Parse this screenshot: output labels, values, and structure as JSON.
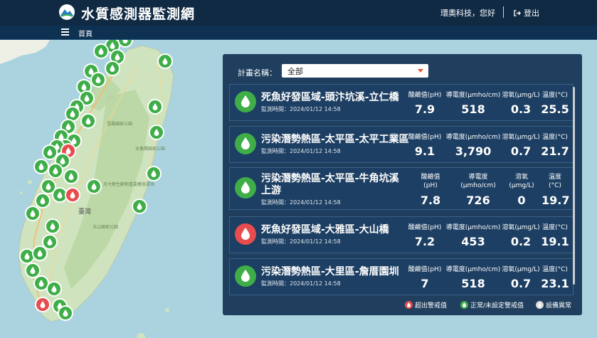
{
  "header": {
    "app_title": "水質感測器監測網",
    "greeting": "環奧科技，您好",
    "logout_label": "登出"
  },
  "nav": {
    "home_label": "首頁"
  },
  "colors": {
    "alert": "#e84c4f",
    "normal": "#3fae49",
    "abnormal": "#d9d9d9",
    "panel": "#163454"
  },
  "map": {
    "labels": [
      "臺灣",
      "玉山國家公園",
      "太魯閣國家公園",
      "雪霸國家公園",
      "月大野生動物重要棲息環境"
    ]
  },
  "filter": {
    "label": "計畫名稱：",
    "selected": "全部"
  },
  "stations": [
    {
      "name": "死魚好發區域-頭汴坑溪-立仁橋",
      "time": "監測時間：2024/01/12 14:58",
      "status": "normal",
      "labels": {
        "ph": "酸鹼值(pH)",
        "ec": "導電度(μmho/cm)",
        "do": "溶氧(μmg/L)",
        "temp": "溫度(°C)"
      },
      "values": {
        "ph": "7.9",
        "ec": "518",
        "do": "0.3",
        "temp": "25.5"
      }
    },
    {
      "name": "污染潛勢熱區-太平區-太平工業區",
      "time": "監測時間：2024/01/12 14:58",
      "status": "normal",
      "labels": {
        "ph": "酸鹼值(pH)",
        "ec": "導電度(μmho/cm)",
        "do": "溶氧(μmg/L)",
        "temp": "溫度(°C)"
      },
      "values": {
        "ph": "9.1",
        "ec": "3,790",
        "do": "0.7",
        "temp": "21.7"
      }
    },
    {
      "name": "污染潛勢熱區-太平區-牛角坑溪上游",
      "time": "監測時間：2024/01/12 14:58",
      "status": "normal",
      "labels": {
        "ph_a": "酸鹼值",
        "ph_b": "(pH)",
        "ec_a": "導電度",
        "ec_b": "(μmho/cm)",
        "do_a": "溶氧",
        "do_b": "(μmg/L)",
        "temp_a": "溫度",
        "temp_b": "(°C)"
      },
      "values": {
        "ph": "7.8",
        "ec": "726",
        "do": "0",
        "temp": "19.7"
      }
    },
    {
      "name": "死魚好發區域-大雅區-大山橋",
      "time": "監測時間：2024/01/12 14:58",
      "status": "alert",
      "labels": {
        "ph": "酸鹼值(pH)",
        "ec": "導電度(μmho/cm)",
        "do": "溶氧(μmg/L)",
        "temp": "溫度(°C)"
      },
      "values": {
        "ph": "7.2",
        "ec": "453",
        "do": "0.2",
        "temp": "19.1"
      }
    },
    {
      "name": "污染潛勢熱區-大里區-詹厝園圳",
      "time": "監測時間：2024/01/12 14:58",
      "status": "normal",
      "labels": {
        "ph": "酸鹼值(pH)",
        "ec": "導電度(μmho/cm)",
        "do": "溶氧(μmg/L)",
        "temp": "溫度(°C)"
      },
      "values": {
        "ph": "7",
        "ec": "518",
        "do": "0.7",
        "temp": "23.1"
      }
    }
  ],
  "legend": {
    "alert": "超出警戒值",
    "normal": "正常/未設定警戒值",
    "abnormal": "設備異常"
  }
}
